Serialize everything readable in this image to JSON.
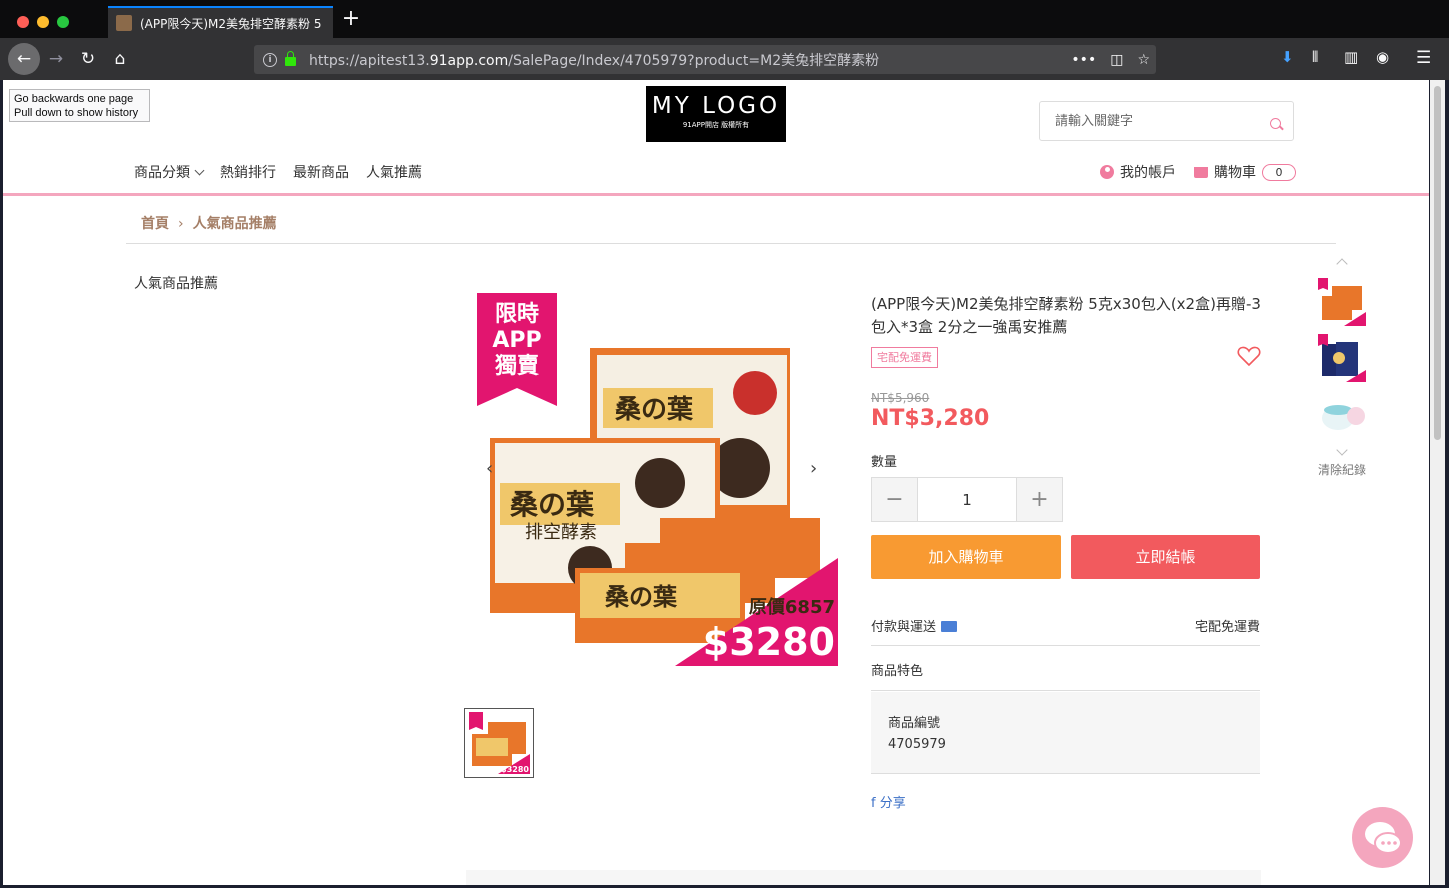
{
  "browser": {
    "tab_title": "(APP限今天)M2美兔排空酵素粉 5",
    "url_prefix": "https://apitest13.",
    "url_domain": "91app.com",
    "url_suffix": "/SalePage/Index/4705979?product=M2美兔排空酵素粉",
    "more": "•••",
    "tooltip_line1": "Go backwards one page",
    "tooltip_line2": "Pull down to show history"
  },
  "header": {
    "logo_main": "MY LOGO",
    "logo_sub": "91APP開店 版權所有",
    "search_placeholder": "請輸入關鍵字",
    "nav": [
      "商品分類",
      "熱銷排行",
      "最新商品",
      "人氣推薦"
    ],
    "account_label": "我的帳戶",
    "cart_label": "購物車",
    "cart_count": "0"
  },
  "breadcrumb": {
    "home": "首頁",
    "sep": "›",
    "current": "人氣商品推薦"
  },
  "sidebar": {
    "title": "人氣商品推薦"
  },
  "product": {
    "title": "(APP限今天)M2美兔排空酵素粉 5克x30包入(x2盒)再贈-3包入*3盒 2分之一強禹安推薦",
    "badge": "宅配免運費",
    "original_price": "NT$5,960",
    "price": "NT$3,280",
    "qty_label": "數量",
    "qty_value": "1",
    "add_to_cart": "加入購物車",
    "buy_now": "立即結帳",
    "payment_label": "付款與運送",
    "payment_value": "宅配免運費",
    "features_label": "商品特色",
    "sku_label": "商品編號",
    "sku_value": "4705979",
    "share": "f 分享"
  },
  "image": {
    "ribbon_line1": "限時",
    "ribbon_line2": "APP",
    "ribbon_line3": "獨賣",
    "box_brand": "桑の葉",
    "box_sub": "排空酵素",
    "orig_tag": "原價6857",
    "promo_price": "$3280",
    "thumb_price": "$3280"
  },
  "recent": {
    "clear": "清除紀錄"
  },
  "colors": {
    "accent_pink": "#f4a6be",
    "price_red": "#f25a5e",
    "cart_orange": "#f89a32",
    "brown": "#a57f67"
  }
}
